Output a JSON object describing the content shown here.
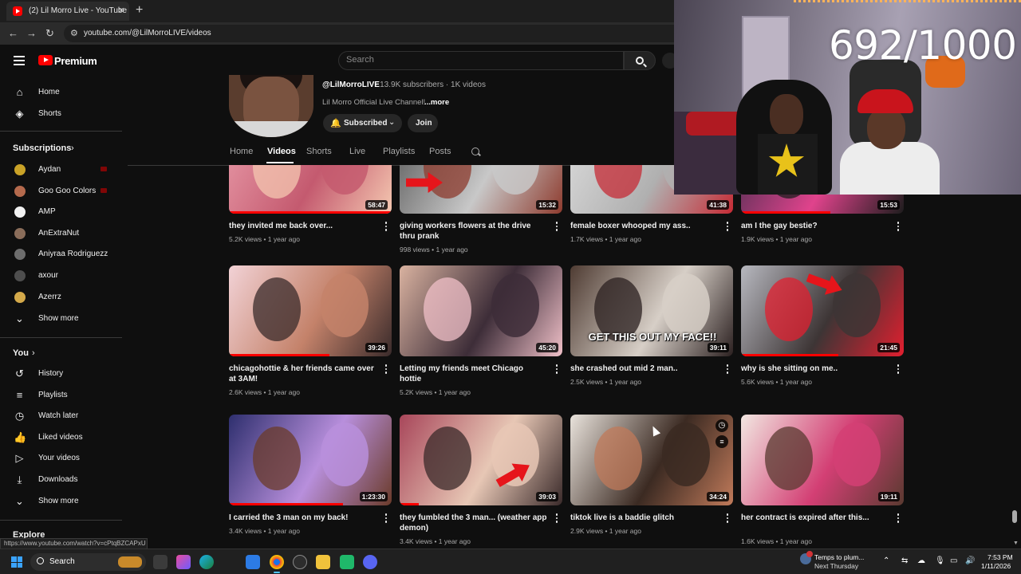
{
  "browser": {
    "tab_title": "(2) Lil Morro Live - YouTube",
    "tab_close": "×",
    "new_tab": "+",
    "url": "youtube.com/@LilMorroLIVE/videos",
    "status_url": "https://www.youtube.com/watch?v=cPtqBZCAPxU"
  },
  "header": {
    "logo_text": "Premium",
    "search_placeholder": "Search"
  },
  "sidebar": {
    "main": [
      {
        "label": "Home",
        "icon": "home-icon",
        "glyph": "⌂"
      },
      {
        "label": "Shorts",
        "icon": "shorts-icon",
        "glyph": "◈"
      }
    ],
    "subscriptions_title": "Subscriptions",
    "subscriptions": [
      {
        "label": "Aydan",
        "color": "#c9a227",
        "live": true
      },
      {
        "label": "Goo Goo Colors",
        "color": "#b56a4d",
        "live": true
      },
      {
        "label": "AMP",
        "color": "#f1f1f1",
        "live": false
      },
      {
        "label": "AnExtraNut",
        "color": "#8a6d5a",
        "live": false
      },
      {
        "label": "Aniyraa Rodriguezz",
        "color": "#6d6d6d",
        "live": false
      },
      {
        "label": "axour",
        "color": "#4e4e4e",
        "live": false
      },
      {
        "label": "Azerrz",
        "color": "#d4a94a",
        "live": false
      }
    ],
    "show_more": "Show more",
    "you_title": "You",
    "you_items": [
      {
        "label": "History",
        "glyph": "↺"
      },
      {
        "label": "Playlists",
        "glyph": "≡"
      },
      {
        "label": "Watch later",
        "glyph": "◷"
      },
      {
        "label": "Liked videos",
        "glyph": "👍"
      },
      {
        "label": "Your videos",
        "glyph": "▷"
      },
      {
        "label": "Downloads",
        "glyph": "⤓"
      }
    ],
    "show_more_2": "Show more",
    "explore_title": "Explore"
  },
  "channel": {
    "handle": "@LilMorroLIVE",
    "meta": "· 13.9K subscribers · 1K videos",
    "description": "Lil Morro Official Live Channel!",
    "more": "...more",
    "subscribed_label": "Subscribed",
    "join_label": "Join",
    "tabs": [
      "Home",
      "Videos",
      "Shorts",
      "Live",
      "Playlists",
      "Posts"
    ],
    "active_tab": "Videos"
  },
  "videos": [
    {
      "title": "they invited me back over...",
      "views": "5.2K views",
      "age": "1 year ago",
      "duration": "58:47"
    },
    {
      "title": "giving workers flowers at the drive thru prank",
      "views": "998 views",
      "age": "1 year ago",
      "duration": "15:32"
    },
    {
      "title": "female boxer whooped my ass..",
      "views": "1.7K views",
      "age": "1 year ago",
      "duration": "41:38"
    },
    {
      "title": "am I the gay bestie?",
      "views": "1.9K views",
      "age": "1 year ago",
      "duration": "15:53"
    },
    {
      "title": "chicagohottie & her friends came over at 3AM!",
      "views": "2.6K views",
      "age": "1 year ago",
      "duration": "39:26"
    },
    {
      "title": "Letting my friends meet Chicago hottie",
      "views": "5.2K views",
      "age": "1 year ago",
      "duration": "45:20"
    },
    {
      "title": "she crashed out mid 2 man..",
      "views": "2.5K views",
      "age": "1 year ago",
      "duration": "39:11",
      "overlay": "GET THIS OUT MY FACE!!"
    },
    {
      "title": "why is she sitting on me..",
      "views": "5.6K views",
      "age": "1 year ago",
      "duration": "21:45"
    },
    {
      "title": "I carried the 3 man on my back!",
      "views": "3.4K views",
      "age": "1 year ago",
      "duration": "1:23:30"
    },
    {
      "title": "they fumbled the 3 man... (weather app demon)",
      "views": "3.4K views",
      "age": "1 year ago",
      "duration": "39:03"
    },
    {
      "title": "tiktok live is a baddie glitch",
      "views": "2.9K views",
      "age": "1 year ago",
      "duration": "34:24"
    },
    {
      "title": "her contract is expired after this...",
      "views": "1.6K views",
      "age": "1 year ago",
      "duration": "19:11"
    }
  ],
  "overlay": {
    "counter": "692/1000"
  },
  "taskbar": {
    "search_label": "Search",
    "weather_line1": "Temps to plum...",
    "weather_line2": "Next Thursday",
    "time": "7:53 PM",
    "date": "1/11/2026"
  }
}
